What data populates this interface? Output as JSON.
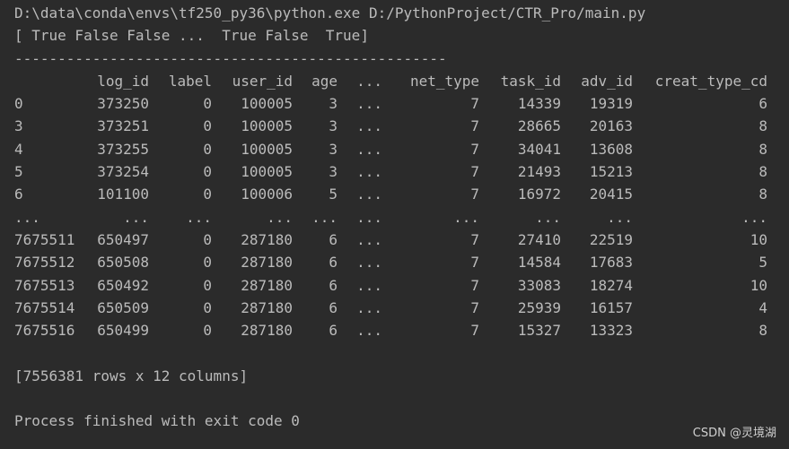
{
  "console": {
    "command_line": "D:\\data\\conda\\envs\\tf250_py36\\python.exe D:/PythonProject/CTR_Pro/main.py",
    "bool_array_line": "[ True False False ...  True False  True]",
    "separator_line": "--------------------------------------------------",
    "table": {
      "columns": [
        "",
        "log_id",
        "label",
        "user_id",
        "age",
        "...",
        "net_type",
        "task_id",
        "adv_id",
        "creat_type_cd"
      ],
      "rows": [
        [
          "0",
          "373250",
          "0",
          "100005",
          "3",
          "...",
          "7",
          "14339",
          "19319",
          "6"
        ],
        [
          "3",
          "373251",
          "0",
          "100005",
          "3",
          "...",
          "7",
          "28665",
          "20163",
          "8"
        ],
        [
          "4",
          "373255",
          "0",
          "100005",
          "3",
          "...",
          "7",
          "34041",
          "13608",
          "8"
        ],
        [
          "5",
          "373254",
          "0",
          "100005",
          "3",
          "...",
          "7",
          "21493",
          "15213",
          "8"
        ],
        [
          "6",
          "101100",
          "0",
          "100006",
          "5",
          "...",
          "7",
          "16972",
          "20415",
          "8"
        ],
        [
          "...",
          "...",
          "...",
          "...",
          "...",
          "...",
          "...",
          "...",
          "...",
          "..."
        ],
        [
          "7675511",
          "650497",
          "0",
          "287180",
          "6",
          "...",
          "7",
          "27410",
          "22519",
          "10"
        ],
        [
          "7675512",
          "650508",
          "0",
          "287180",
          "6",
          "...",
          "7",
          "14584",
          "17683",
          "5"
        ],
        [
          "7675513",
          "650492",
          "0",
          "287180",
          "6",
          "...",
          "7",
          "33083",
          "18274",
          "10"
        ],
        [
          "7675514",
          "650509",
          "0",
          "287180",
          "6",
          "...",
          "7",
          "25939",
          "16157",
          "4"
        ],
        [
          "7675516",
          "650499",
          "0",
          "287180",
          "6",
          "...",
          "7",
          "15327",
          "13323",
          "8"
        ]
      ]
    },
    "shape_line": "[7556381 rows x 12 columns]",
    "exit_line": "Process finished with exit code 0"
  },
  "watermark": "CSDN @灵境湖",
  "colors": {
    "background": "#2b2b2b",
    "text": "#bbbbbb"
  }
}
